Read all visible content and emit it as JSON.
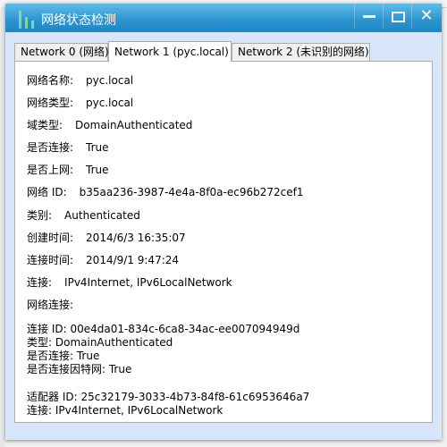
{
  "window": {
    "title": "网络状态检测",
    "controls": {
      "minimize": "minimize",
      "maximize": "maximize",
      "close": "✕"
    }
  },
  "tabs": [
    {
      "label": "Network 0 (网络)",
      "active": false
    },
    {
      "label": "Network 1 (pyc.local)",
      "active": true
    },
    {
      "label": "Network 2 (未识别的网络)",
      "active": false
    }
  ],
  "fields": [
    {
      "label": "网络名称:",
      "value": "pyc.local"
    },
    {
      "label": "网络类型:",
      "value": "pyc.local"
    },
    {
      "label": "域类型:",
      "value": "DomainAuthenticated"
    },
    {
      "label": "是否连接:",
      "value": "True"
    },
    {
      "label": "是否上网:",
      "value": "True"
    },
    {
      "label": "网络 ID:",
      "value": "b35aa236-3987-4e4a-8f0a-ec96b272cef1"
    },
    {
      "label": "类别:",
      "value": "Authenticated"
    },
    {
      "label": "创建时间:",
      "value": "2014/6/3 16:35:07"
    },
    {
      "label": "连接时间:",
      "value": "2014/9/1 9:47:24"
    },
    {
      "label": "连接:",
      "value": "IPv4Internet, IPv6LocalNetwork"
    },
    {
      "label": "网络连接:",
      "value": ""
    }
  ],
  "connection_details": [
    "连接 ID: 00e4da01-834c-6ca8-34ac-ee007094949d",
    "类型: DomainAuthenticated",
    "是否连接: True",
    "是否连接因特网: True"
  ],
  "adapter_details": [
    "适配器 ID: 25c32179-3033-4b73-84f8-61c6953646a7",
    "连接: IPv4Internet, IPv6LocalNetwork"
  ]
}
